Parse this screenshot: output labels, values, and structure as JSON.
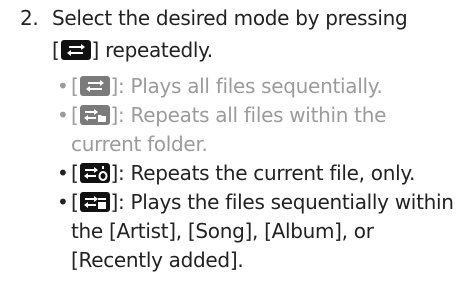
{
  "step": {
    "number": "2.",
    "line1": "Select the desired mode by pressing",
    "line2_before": "[",
    "line2_after": "] repeatedly.",
    "icon": "repeat-all-icon"
  },
  "bullets": [
    {
      "icon": "repeat-all-icon",
      "text": "]: Plays all files sequentially.",
      "faded": true
    },
    {
      "icon": "repeat-folder-icon",
      "text": "]: Repeats all files within the current folder.",
      "faded": true
    },
    {
      "icon": "repeat-one-icon",
      "text": "]: Repeats the current file, only.",
      "faded": false
    },
    {
      "icon": "repeat-category-icon",
      "text": "]: Plays the files sequentially within the [Artist], [Song], [Album], or [Recently added].",
      "faded": false
    }
  ],
  "bullet_open": "[",
  "bullet_dot": "•"
}
